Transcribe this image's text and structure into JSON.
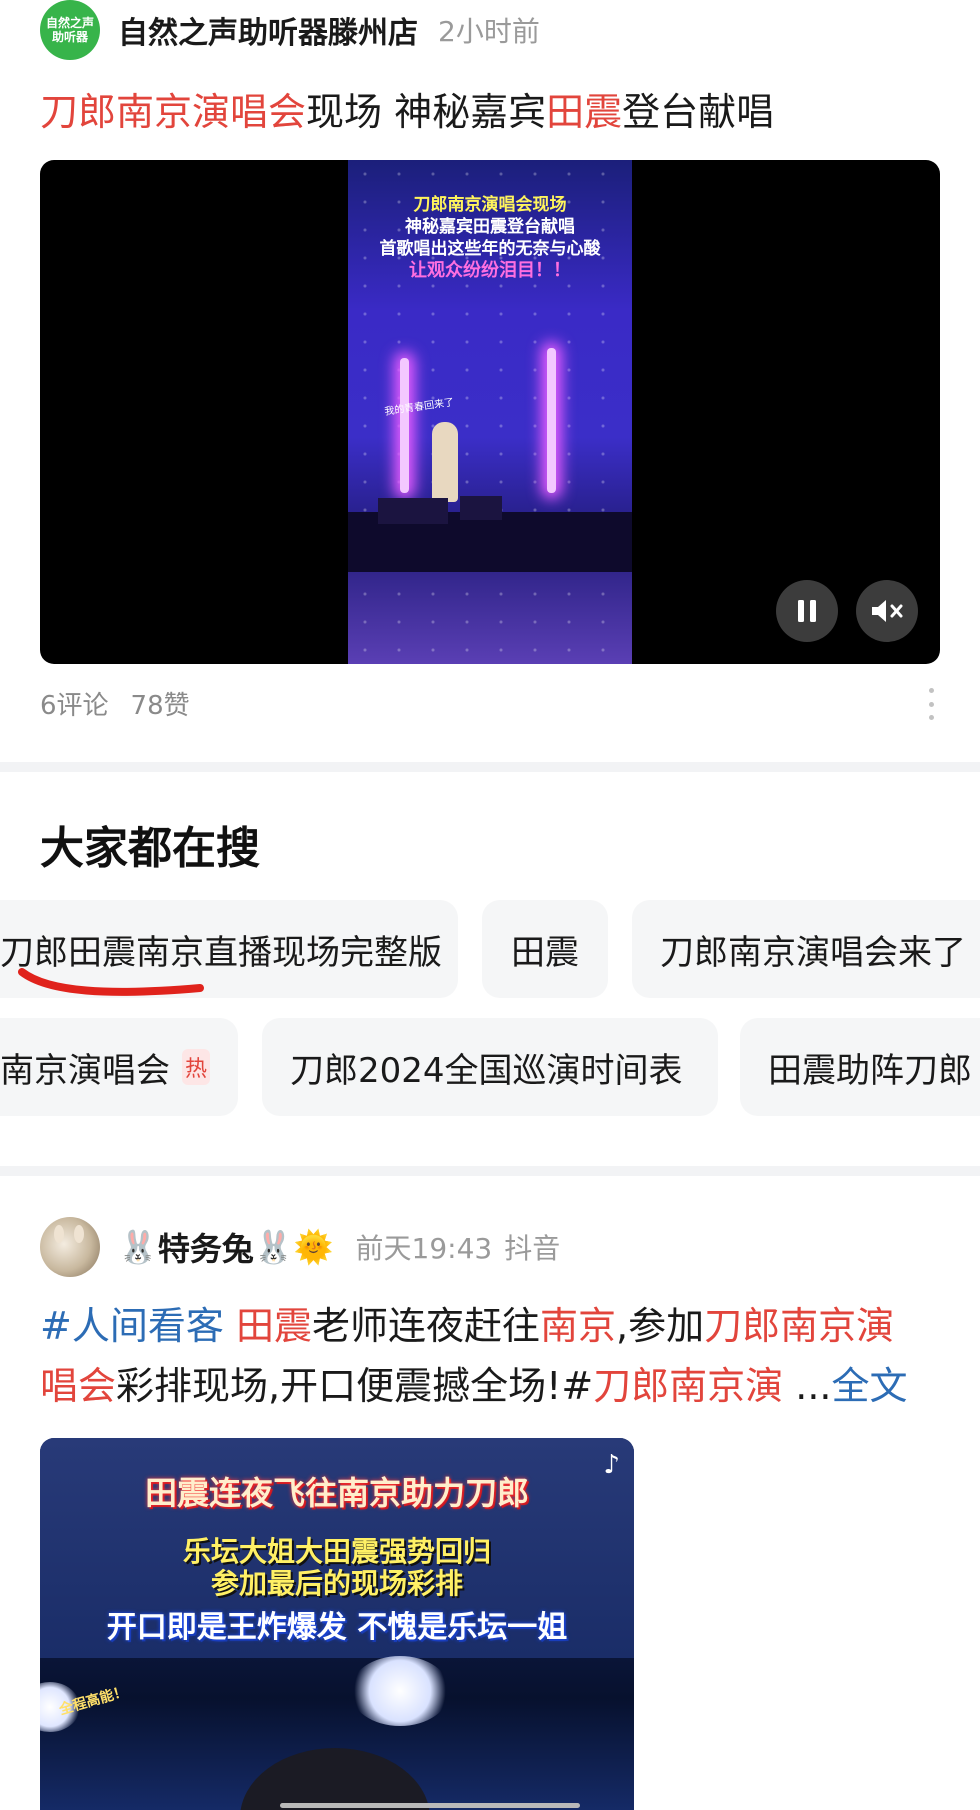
{
  "post1": {
    "avatar_text_line1": "自然之声",
    "avatar_text_line2": "助听器",
    "author": "自然之声助听器滕州店",
    "time": "2小时前",
    "title_parts": [
      "刀郎南京演唱会",
      "现场 神秘嘉宾",
      "田震",
      "登台献唱"
    ],
    "video": {
      "caption_line1": "刀郎南京演唱会现场",
      "caption_line2": "神秘嘉宾田震登台献唱",
      "caption_line3": "首歌唱出这些年的无奈与心酸",
      "caption_line4": "让观众纷纷泪目！！",
      "stage_text": "我的青春回来了",
      "pause_icon": "pause-icon",
      "mute_icon": "mute-icon"
    },
    "comments": "6评论",
    "likes": "78赞"
  },
  "search": {
    "title": "大家都在搜",
    "chips": [
      {
        "label": "刀郎田震南京直播现场完整版"
      },
      {
        "label": "田震"
      },
      {
        "label": "刀郎南京演唱会来了"
      },
      {
        "label": "南京演唱会",
        "badge": "热"
      },
      {
        "label": "刀郎2024全国巡演时间表"
      },
      {
        "label": "田震助阵刀郎"
      }
    ],
    "underline_color": "#e0231c"
  },
  "post2": {
    "author": "特务兔",
    "emoji_prefix": "🐰",
    "emoji_suffix_1": "🐰",
    "emoji_suffix_2": "🌞",
    "time": "前天19:43",
    "source": "抖音",
    "text_line1_parts": [
      "#人间看客",
      " ",
      "田震",
      "老师连夜赶往",
      "南京",
      ",参加",
      "刀郎南京演"
    ],
    "text_line2_parts": [
      "唱会",
      "彩排现场,开口便震撼全场!#",
      "刀郎南京演",
      " ...",
      "全文"
    ],
    "image": {
      "caption1": "田震连夜飞往南京助力刀郎",
      "caption2": "乐坛大姐大田震强势回归",
      "caption3": "参加最后的现场彩排",
      "caption4": "开口即是王炸爆发 不愧是乐坛一姐",
      "sticker": "全程高能！",
      "platform_icon": "tiktok-icon"
    }
  },
  "colors": {
    "highlight_red": "#e2453c",
    "link_blue": "#2c6cb5",
    "meta_gray": "#9a9a9a",
    "avatar_green": "#37b44a"
  }
}
